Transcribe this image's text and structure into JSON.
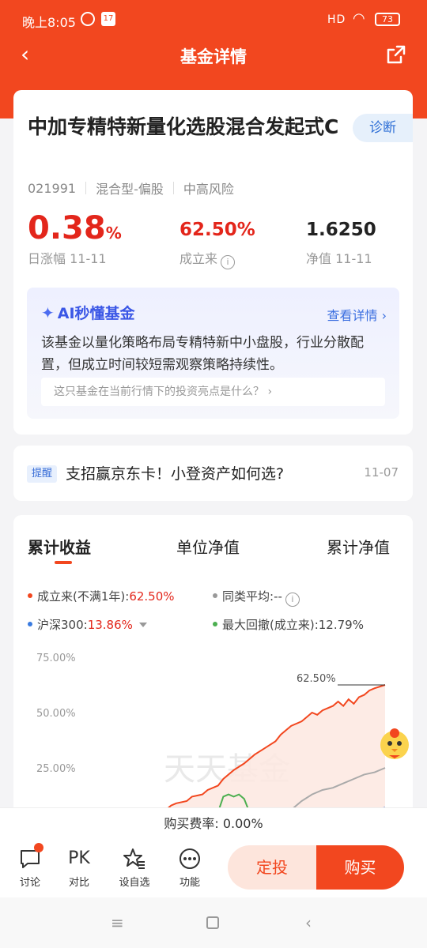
{
  "status_bar": {
    "time": "晚上8:05",
    "calendar_day": "17",
    "signal": "HD",
    "battery": "73"
  },
  "nav": {
    "title": "基金详情",
    "back_icon": "chevron-left-icon",
    "share_icon": "share-icon"
  },
  "fund": {
    "name": "中加专精特新量化选股混合发起式C",
    "diagnose_label": "诊断",
    "code": "021991",
    "type": "混合型-偏股",
    "risk": "中高风险",
    "daily_change": "0.38",
    "daily_change_unit": "%",
    "daily_change_label": "日涨幅 11-11",
    "since_inception": "62.50%",
    "since_inception_label": "成立来",
    "nav_value": "1.6250",
    "nav_label": "净值 11-11"
  },
  "ai": {
    "title": "AI秒懂基金",
    "link": "查看详情",
    "summary": "该基金以量化策略布局专精特新中小盘股，行业分散配置，但成立时间较短需观察策略持续性。",
    "prompt": "这只基金在当前行情下的投资亮点是什么？"
  },
  "notice": {
    "tag": "提醒",
    "text": "支招赢京东卡！小登资产如何选?",
    "date": "11-07"
  },
  "chart_tabs": [
    "累计收益",
    "单位净值",
    "累计净值"
  ],
  "legend": {
    "fund": {
      "label": "成立来(不满1年):",
      "value": "62.50%",
      "color": "#f2471f"
    },
    "peer": {
      "label": "同类平均:",
      "value": "--",
      "color": "#999999"
    },
    "hs300": {
      "label": "沪深300:",
      "value": "13.86%",
      "color": "#3a7be0"
    },
    "drawdown": {
      "label": "最大回撤(成立来):",
      "value": "12.79%",
      "color": "#4caf50"
    }
  },
  "chart_data": {
    "type": "line",
    "yticks": [
      "75.00%",
      "50.00%",
      "25.00%"
    ],
    "ylim": [
      0,
      75
    ],
    "end_label": "62.50%",
    "watermark": "天天基金",
    "series": [
      {
        "name": "成立来",
        "color": "#f2471f",
        "fill": true,
        "points": [
          [
            0,
            -4
          ],
          [
            6,
            -2
          ],
          [
            10,
            0
          ],
          [
            14,
            3
          ],
          [
            16,
            6
          ],
          [
            18,
            8
          ],
          [
            20,
            9
          ],
          [
            24,
            10
          ],
          [
            26,
            12
          ],
          [
            30,
            13
          ],
          [
            32,
            15
          ],
          [
            36,
            17
          ],
          [
            38,
            20
          ],
          [
            42,
            24
          ],
          [
            46,
            27
          ],
          [
            50,
            31
          ],
          [
            54,
            34
          ],
          [
            58,
            37
          ],
          [
            60,
            40
          ],
          [
            62,
            42
          ],
          [
            64,
            44
          ],
          [
            68,
            46
          ],
          [
            70,
            48
          ],
          [
            72,
            50
          ],
          [
            74,
            49
          ],
          [
            76,
            51
          ],
          [
            80,
            53
          ],
          [
            82,
            55
          ],
          [
            84,
            53
          ],
          [
            86,
            56
          ],
          [
            88,
            54
          ],
          [
            90,
            57
          ],
          [
            92,
            58
          ],
          [
            94,
            60
          ],
          [
            96,
            61
          ],
          [
            100,
            62.5
          ]
        ]
      },
      {
        "name": "同类平均",
        "color": "#aaaaaa",
        "fill": false,
        "points": [
          [
            58,
            2
          ],
          [
            64,
            6
          ],
          [
            68,
            10
          ],
          [
            72,
            13
          ],
          [
            76,
            15
          ],
          [
            80,
            16
          ],
          [
            84,
            18
          ],
          [
            88,
            20
          ],
          [
            92,
            22
          ],
          [
            96,
            23
          ],
          [
            100,
            25
          ]
        ]
      },
      {
        "name": "沪深300",
        "color": "#3a7be0",
        "fill": false,
        "points": [
          [
            76,
            1
          ],
          [
            80,
            2
          ],
          [
            84,
            3
          ],
          [
            88,
            4
          ],
          [
            92,
            5
          ],
          [
            96,
            6
          ],
          [
            100,
            7
          ]
        ]
      },
      {
        "name": "最大回撤",
        "color": "#4caf50",
        "fill": false,
        "points": [
          [
            36,
            5
          ],
          [
            38,
            12
          ],
          [
            40,
            13
          ],
          [
            42,
            12
          ],
          [
            44,
            13
          ],
          [
            46,
            11
          ],
          [
            48,
            5
          ]
        ]
      }
    ]
  },
  "fee": "购买费率: 0.00%",
  "bottom": {
    "items": [
      {
        "label": "讨论",
        "icon": "chat-icon"
      },
      {
        "label": "对比",
        "icon": "PK"
      },
      {
        "label": "设自选",
        "icon": "star-icon"
      },
      {
        "label": "功能",
        "icon": "more-icon"
      }
    ],
    "dingtou": "定投",
    "buy": "购买"
  }
}
